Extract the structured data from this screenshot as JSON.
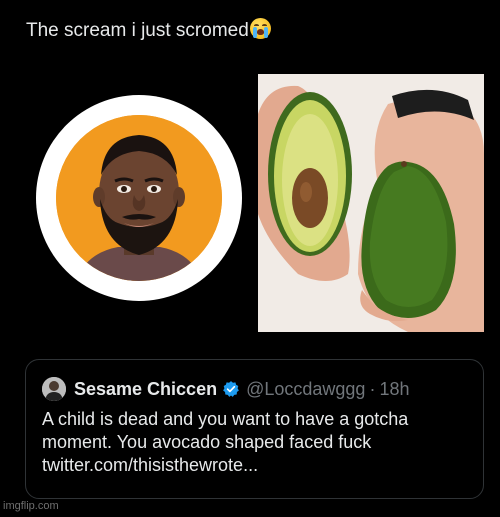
{
  "post": {
    "text": "The scream i just scromed",
    "emoji": "loudly-crying-face-emoji"
  },
  "images": {
    "left": "avatar-portrait",
    "right": "avocado-halves-photo"
  },
  "quote": {
    "name": "Sesame Chiccen",
    "handle": "@Loccdawggg",
    "separator": "·",
    "time": "18h",
    "lines": [
      "A child is dead and you want to have a gotcha",
      "moment. You avocado shaped faced fuck",
      "twitter.com/thisisthewrote..."
    ]
  },
  "watermark": "imgflip.com",
  "colors": {
    "background": "#000000",
    "text": "#e7e9ea",
    "muted": "#71767b",
    "verified": "#1d9bf0",
    "card_border": "#2f3336",
    "avatar_bg": "#f29a1f"
  }
}
